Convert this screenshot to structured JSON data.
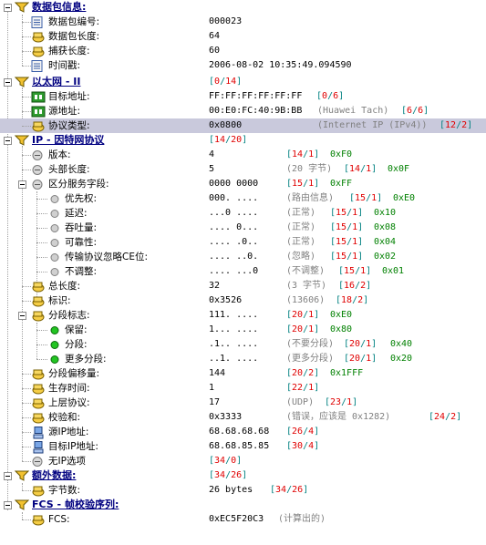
{
  "sections": {
    "packet_info": {
      "label": "数据包信息:"
    },
    "ethernet": {
      "label": "以太网 - II",
      "brackets": {
        "a": "0",
        "b": "14"
      }
    },
    "ip": {
      "label": "IP - 因特网协议",
      "brackets": {
        "a": "14",
        "b": "20"
      }
    },
    "extra": {
      "label": "额外数据:",
      "brackets": {
        "a": "34",
        "b": "26"
      }
    },
    "fcs": {
      "label": "FCS - 帧校验序列:"
    }
  },
  "rows": {
    "pkt_no": {
      "label": "数据包编号:",
      "value": "000023"
    },
    "pkt_len": {
      "label": "数据包长度:",
      "value": "64"
    },
    "cap_len": {
      "label": "捕获长度:",
      "value": "60"
    },
    "timestamp": {
      "label": "时间戳:",
      "value": "2006-08-02 10:35:49.094590"
    },
    "dst_mac": {
      "label": "目标地址:",
      "value": "FF:FF:FF:FF:FF:FF",
      "br": {
        "a": "0",
        "b": "6"
      }
    },
    "src_mac": {
      "label": "源地址:",
      "value": "00:E0:FC:40:9B:BB",
      "desc": "(Huawei Tach)",
      "br": {
        "a": "6",
        "b": "6"
      }
    },
    "proto_type": {
      "label": "协议类型:",
      "value": "0x0800",
      "desc": "(Internet IP (IPv4))",
      "br": {
        "a": "12",
        "b": "2"
      }
    },
    "version": {
      "label": "版本:",
      "value": "4",
      "br": {
        "a": "14",
        "b": "1"
      },
      "hex": "0xF0"
    },
    "hdr_len": {
      "label": "头部长度:",
      "value": "5",
      "desc": "(20 字节)",
      "br": {
        "a": "14",
        "b": "1"
      },
      "hex": "0x0F"
    },
    "dsf": {
      "label": "区分服务字段:",
      "value": "0000 0000",
      "br": {
        "a": "15",
        "b": "1"
      },
      "hex": "0xFF"
    },
    "priority": {
      "label": "优先权:",
      "value": "000. ....",
      "desc": "(路由信息)",
      "br": {
        "a": "15",
        "b": "1"
      },
      "hex": "0xE0"
    },
    "delay": {
      "label": "延迟:",
      "value": "...0 ....",
      "desc": "(正常)",
      "br": {
        "a": "15",
        "b": "1"
      },
      "hex": "0x10"
    },
    "throughput": {
      "label": "吞吐量:",
      "value": ".... 0...",
      "desc": "(正常)",
      "br": {
        "a": "15",
        "b": "1"
      },
      "hex": "0x08"
    },
    "reliability": {
      "label": "可靠性:",
      "value": ".... .0..",
      "desc": "(正常)",
      "br": {
        "a": "15",
        "b": "1"
      },
      "hex": "0x04"
    },
    "ce": {
      "label": "传输协议忽略CE位:",
      "value": ".... ..0.",
      "desc": "(忽略)",
      "br": {
        "a": "15",
        "b": "1"
      },
      "hex": "0x02"
    },
    "unused": {
      "label": "不调整:",
      "value": ".... ...0",
      "desc": "(不调整)",
      "br": {
        "a": "15",
        "b": "1"
      },
      "hex": "0x01"
    },
    "total_len": {
      "label": "总长度:",
      "value": "32",
      "desc": "(3 字节)",
      "br": {
        "a": "16",
        "b": "2"
      }
    },
    "ident": {
      "label": "标识:",
      "value": "0x3526",
      "desc": "(13606)",
      "br": {
        "a": "18",
        "b": "2"
      }
    },
    "frag_flags": {
      "label": "分段标志:",
      "value": "111. ....",
      "br": {
        "a": "20",
        "b": "1"
      },
      "hex": "0xE0"
    },
    "reserved": {
      "label": "保留:",
      "value": "1... ....",
      "br": {
        "a": "20",
        "b": "1"
      },
      "hex": "0x80"
    },
    "df": {
      "label": "分段:",
      "value": ".1.. ....",
      "desc": "(不要分段)",
      "br": {
        "a": "20",
        "b": "1"
      },
      "hex": "0x40"
    },
    "mf": {
      "label": "更多分段:",
      "value": "..1. ....",
      "desc": "(更多分段)",
      "br": {
        "a": "20",
        "b": "1"
      },
      "hex": "0x20"
    },
    "frag_off": {
      "label": "分段偏移量:",
      "value": "144",
      "br": {
        "a": "20",
        "b": "2"
      },
      "hex": "0x1FFF"
    },
    "ttl": {
      "label": "生存时间:",
      "value": "1",
      "br": {
        "a": "22",
        "b": "1"
      }
    },
    "proto": {
      "label": "上层协议:",
      "value": "17",
      "desc": "(UDP)",
      "br": {
        "a": "23",
        "b": "1"
      }
    },
    "checksum": {
      "label": "校验和:",
      "value": "0x3333",
      "desc": "(错误，应该是 0x1282)",
      "br": {
        "a": "24",
        "b": "2"
      }
    },
    "src_ip": {
      "label": "源IP地址:",
      "value": "68.68.68.68",
      "br": {
        "a": "26",
        "b": "4"
      }
    },
    "dst_ip": {
      "label": "目标IP地址:",
      "value": "68.68.85.85",
      "br": {
        "a": "30",
        "b": "4"
      }
    },
    "no_opt": {
      "label": "无IP选项",
      "br": {
        "a": "34",
        "b": "0"
      }
    },
    "bytes": {
      "label": "字节数:",
      "value": "26 bytes",
      "br": {
        "a": "34",
        "b": "26"
      }
    },
    "fcs_val": {
      "label": "FCS:",
      "value": "0xEC5F20C3",
      "desc": "(计算出的)"
    }
  },
  "colors": {
    "section": "#000080",
    "bracket": "#008080",
    "bracket_num": "#e00000",
    "hex": "#008000",
    "highlight": "#c9c9dc"
  },
  "icons": {
    "section": "tree-filter-icon",
    "field": "yellow-field-icon",
    "note": "document-icon",
    "mac": "green-network-icon",
    "bit": "grey-circle-icon",
    "bit_on": "green-dot-icon",
    "ip": "computer-icon"
  }
}
